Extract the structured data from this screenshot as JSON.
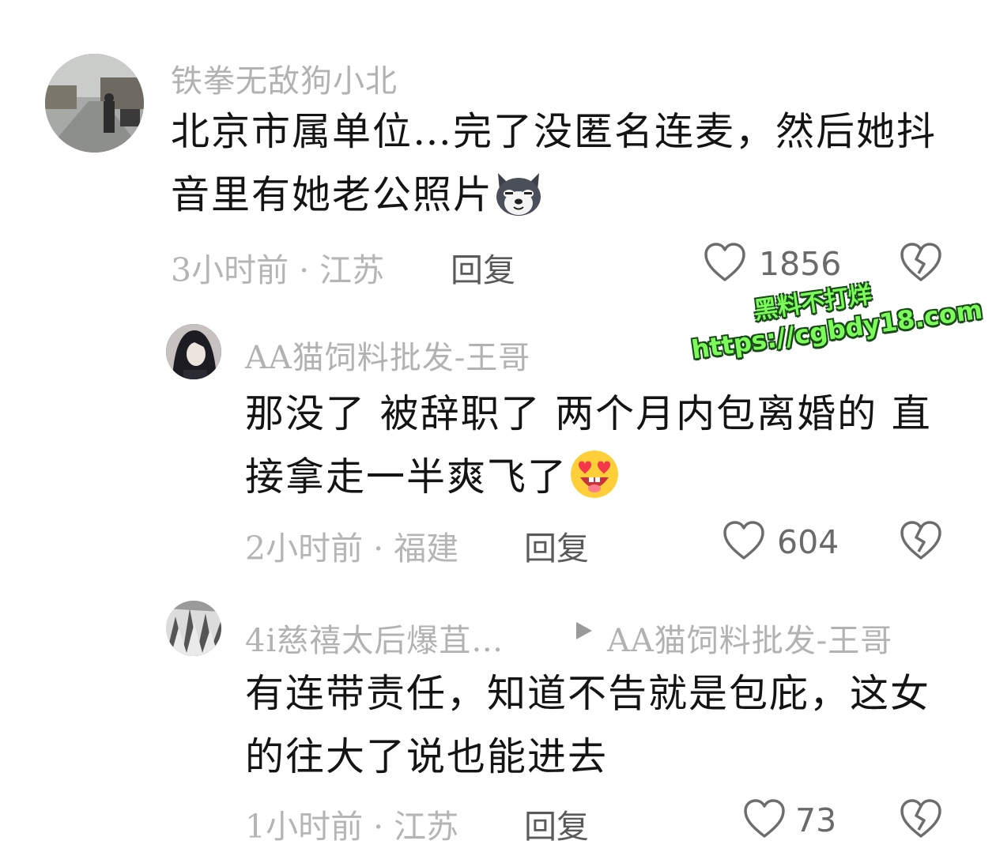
{
  "top_cut_text": "",
  "comments": [
    {
      "username": "铁拳无敌狗小北",
      "text": "北京市属单位…完了没匿名连麦，然后她抖音里有她老公照片",
      "text_line1": "北京市属单位…完了没匿名连麦，然后她抖",
      "text_line2": "音里有她老公照片",
      "emoji": "dog-face-emoji",
      "time": "3小时前",
      "location": "江苏",
      "meta": "3小时前 · 江苏",
      "reply_label": "回复",
      "likes": "1856"
    },
    {
      "username": "AA猫饲料批发-王哥",
      "text_line1": "那没了 被辞职了 两个月内包离婚的 直",
      "text_line2": "接拿走一半爽飞了",
      "emoji": "heart-eyes-emoji",
      "meta": "2小时前 · 福建",
      "reply_label": "回复",
      "likes": "604"
    },
    {
      "username": "4i慈禧太后爆苴…",
      "reply_to": "AA猫饲料批发-王哥",
      "text_line1": "有连带责任，知道不告就是包庇，这女",
      "text_line2": "的往大了说也能进去",
      "meta": "1小时前 · 江苏",
      "reply_label": "回复",
      "likes": "73"
    }
  ],
  "watermark": {
    "line1": "黑料不打烊",
    "line2": "https://cgbdy18.com"
  },
  "colors": {
    "username": "#b2b2b2",
    "text": "#141414",
    "meta": "#b5b5b5",
    "watermark": "#7CFC5A"
  }
}
